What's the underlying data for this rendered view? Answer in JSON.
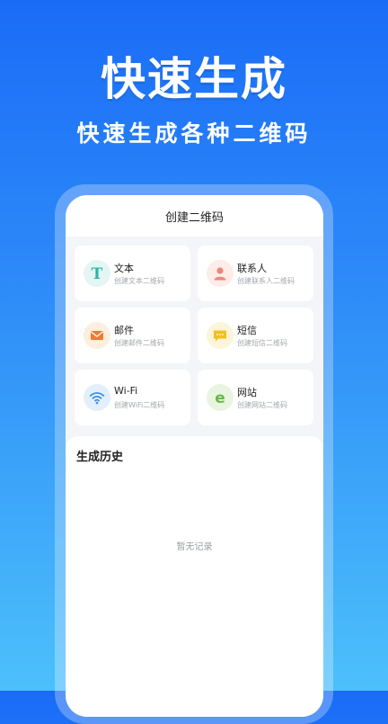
{
  "hero": {
    "title": "快速生成",
    "subtitle": "快速生成各种二维码"
  },
  "screen": {
    "header_title": "创建二维码",
    "tiles": [
      {
        "title": "文本",
        "subtitle": "创建文本二维码",
        "icon": "text-t-icon",
        "icon_color": "#2bb5a4",
        "icon_bg": "#e4f6f3"
      },
      {
        "title": "联系人",
        "subtitle": "创建联系人二维码",
        "icon": "person-icon",
        "icon_color": "#e98a76",
        "icon_bg": "#fdece8"
      },
      {
        "title": "邮件",
        "subtitle": "创建邮件二维码",
        "icon": "envelope-icon",
        "icon_color": "#f17a35",
        "icon_bg": "#fdeede"
      },
      {
        "title": "短信",
        "subtitle": "创建短信二维码",
        "icon": "chat-bubble-icon",
        "icon_color": "#f1c021",
        "icon_bg": "#fdf5d9"
      },
      {
        "title": "Wi-Fi",
        "subtitle": "创建WiFi二维码",
        "icon": "wifi-icon",
        "icon_color": "#3b8fe0",
        "icon_bg": "#e3effb"
      },
      {
        "title": "网站",
        "subtitle": "创建网站二维码",
        "icon": "browser-e-icon",
        "icon_color": "#67b84a",
        "icon_bg": "#e9f5e1"
      }
    ],
    "history": {
      "title": "生成历史",
      "empty_text": "暂无记录"
    }
  },
  "colors": {
    "background_top": "#1a6cf7",
    "background_bottom": "#4cc0fb",
    "card": "#ffffff",
    "screen_bg": "#f3f5f8"
  }
}
